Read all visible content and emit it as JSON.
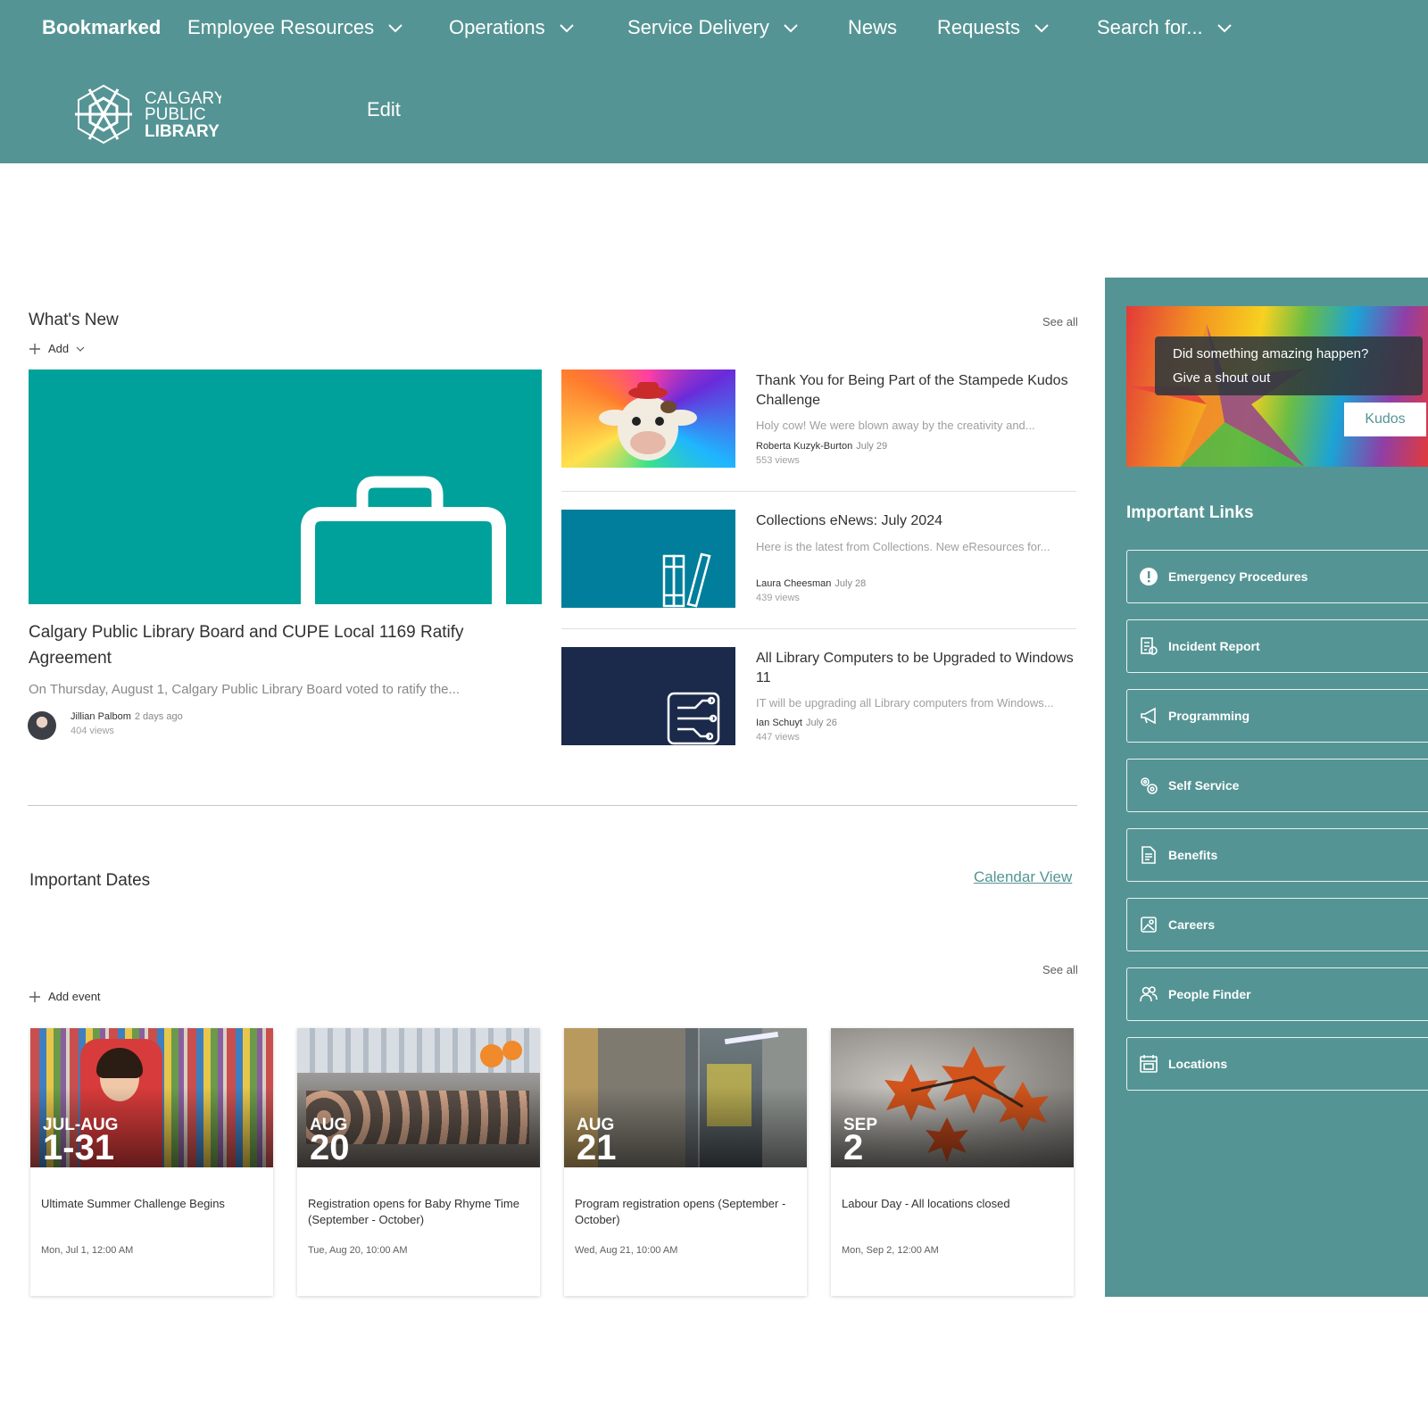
{
  "nav": {
    "brand": "Bookmarked",
    "items": [
      {
        "label": "Employee Resources"
      },
      {
        "label": "Operations"
      },
      {
        "label": "Service Delivery"
      },
      {
        "label": "News"
      },
      {
        "label": "Requests"
      },
      {
        "label": "Search for..."
      }
    ]
  },
  "site": {
    "logo_line1": "CALGARY",
    "logo_line2": "PUBLIC",
    "logo_line3": "LIBRARY",
    "edit_label": "Edit"
  },
  "whats_new": {
    "title": "What's New",
    "see_all": "See all",
    "add_label": "Add",
    "hero": {
      "title": "Calgary Public Library Board and CUPE Local 1169 Ratify Agreement",
      "desc": "On Thursday, August 1, Calgary Public Library Board voted to ratify the...",
      "author": "Jillian Palbom",
      "date": "2 days ago",
      "views": "404 views"
    },
    "items": [
      {
        "title": "Thank You for Being Part of the Stampede Kudos Challenge",
        "desc": "Holy cow! We were blown away by the creativity and...",
        "author": "Roberta Kuzyk-Burton",
        "date": "July 29",
        "views": "553 views"
      },
      {
        "title": "Collections eNews: July 2024",
        "desc": "Here is the latest from Collections. New eResources for...",
        "author": "Laura Cheesman",
        "date": "July 28",
        "views": "439 views"
      },
      {
        "title": "All Library Computers to be Upgraded to Windows 11",
        "desc": "IT will be upgrading all Library computers from Windows...",
        "author": "Ian Schuyt",
        "date": "July 26",
        "views": "447 views"
      }
    ]
  },
  "important_dates": {
    "title": "Important Dates",
    "calendar_view": "Calendar View",
    "see_all": "See all",
    "add_event": "Add event",
    "events": [
      {
        "month": "JUL-AUG",
        "day": "1-31",
        "title": "Ultimate Summer Challenge Begins",
        "time": "Mon, Jul 1, 12:00 AM"
      },
      {
        "month": "AUG",
        "day": "20",
        "title": "Registration opens for Baby Rhyme Time (September - October)",
        "time": "Tue, Aug 20, 10:00 AM"
      },
      {
        "month": "AUG",
        "day": "21",
        "title": "Program registration opens (September - October)",
        "time": "Wed, Aug 21, 10:00 AM"
      },
      {
        "month": "SEP",
        "day": "2",
        "title": "Labour Day - All locations closed",
        "time": "Mon, Sep 2, 12:00 AM"
      }
    ]
  },
  "kudos": {
    "line1": "Did something amazing happen?",
    "line2": "Give a shout out",
    "button": "Kudos"
  },
  "important_links": {
    "title": "Important Links",
    "items": [
      {
        "label": "Emergency Procedures",
        "icon": "alert-icon"
      },
      {
        "label": "Incident Report",
        "icon": "report-icon"
      },
      {
        "label": "Programming",
        "icon": "megaphone-icon"
      },
      {
        "label": "Self Service",
        "icon": "gears-icon"
      },
      {
        "label": "Benefits",
        "icon": "document-icon"
      },
      {
        "label": "Careers",
        "icon": "picture-icon"
      },
      {
        "label": "People Finder",
        "icon": "people-icon"
      },
      {
        "label": "Locations",
        "icon": "calendar-icon"
      }
    ]
  },
  "colors": {
    "teal": "#559494",
    "hero_teal": "#00a19a",
    "navy": "#1b2a4a"
  }
}
